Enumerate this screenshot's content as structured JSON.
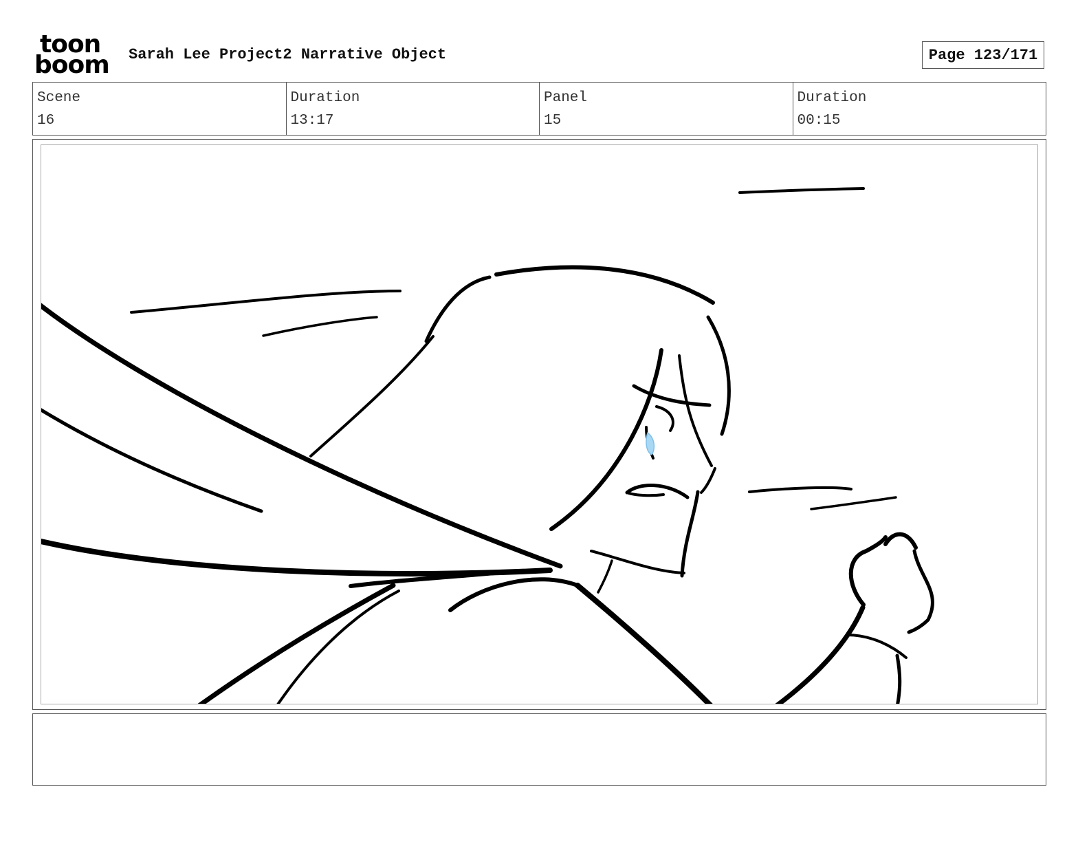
{
  "header": {
    "logo": {
      "line1": "toon",
      "line2": "boom"
    },
    "project_title": "Sarah Lee Project2 Narrative Object",
    "page_label": "Page 123/171"
  },
  "info": {
    "scene_label": "Scene",
    "scene_value": "16",
    "scene_duration_label": "Duration",
    "scene_duration_value": "13:17",
    "panel_label": "Panel",
    "panel_value": "15",
    "panel_duration_label": "Duration",
    "panel_duration_value": "00:15"
  },
  "panel": {
    "accent_color": "#a9d8f5",
    "line_color": "#000000"
  },
  "notes": {
    "text": ""
  }
}
